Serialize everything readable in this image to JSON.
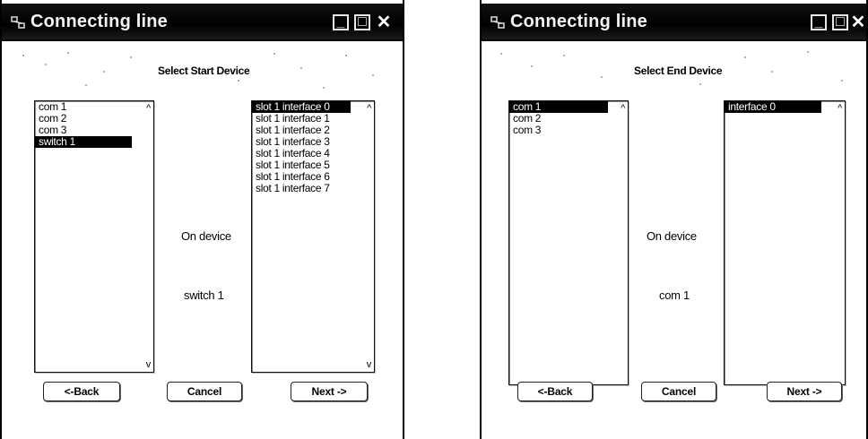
{
  "left_window": {
    "title": "Connecting line",
    "heading": "Select Start Device",
    "devices": [
      "com 1",
      "com 2",
      "com 3",
      "switch 1"
    ],
    "selected_device_index": 3,
    "interfaces": [
      "slot 1 interface 0",
      "slot 1 interface 1",
      "slot 1 interface 2",
      "slot 1 interface 3",
      "slot 1 interface 4",
      "slot 1 interface 5",
      "slot 1 interface 6",
      "slot 1 interface 7"
    ],
    "selected_interface_index": 0,
    "on_device_label": "On device",
    "current_device": "switch 1",
    "back_label": "<-Back",
    "cancel_label": "Cancel",
    "next_label": "Next ->"
  },
  "right_window": {
    "title": "Connecting line",
    "heading": "Select End Device",
    "devices": [
      "com 1",
      "com 2",
      "com 3"
    ],
    "selected_device_index": 0,
    "interfaces": [
      "interface 0"
    ],
    "selected_interface_index": 0,
    "on_device_label": "On device",
    "current_device": "com 1",
    "back_label": "<-Back",
    "cancel_label": "Cancel",
    "next_label": "Next ->"
  },
  "icons": {
    "window": "window-app-icon",
    "minimize": "minimize-icon",
    "maximize": "maximize-icon",
    "close": "close-icon",
    "scroll_up": "scroll-up-arrow-icon",
    "scroll_down": "scroll-down-arrow-icon"
  },
  "colors": {
    "titlebar": "#000000",
    "selection": "#000000",
    "background": "#ffffff"
  }
}
